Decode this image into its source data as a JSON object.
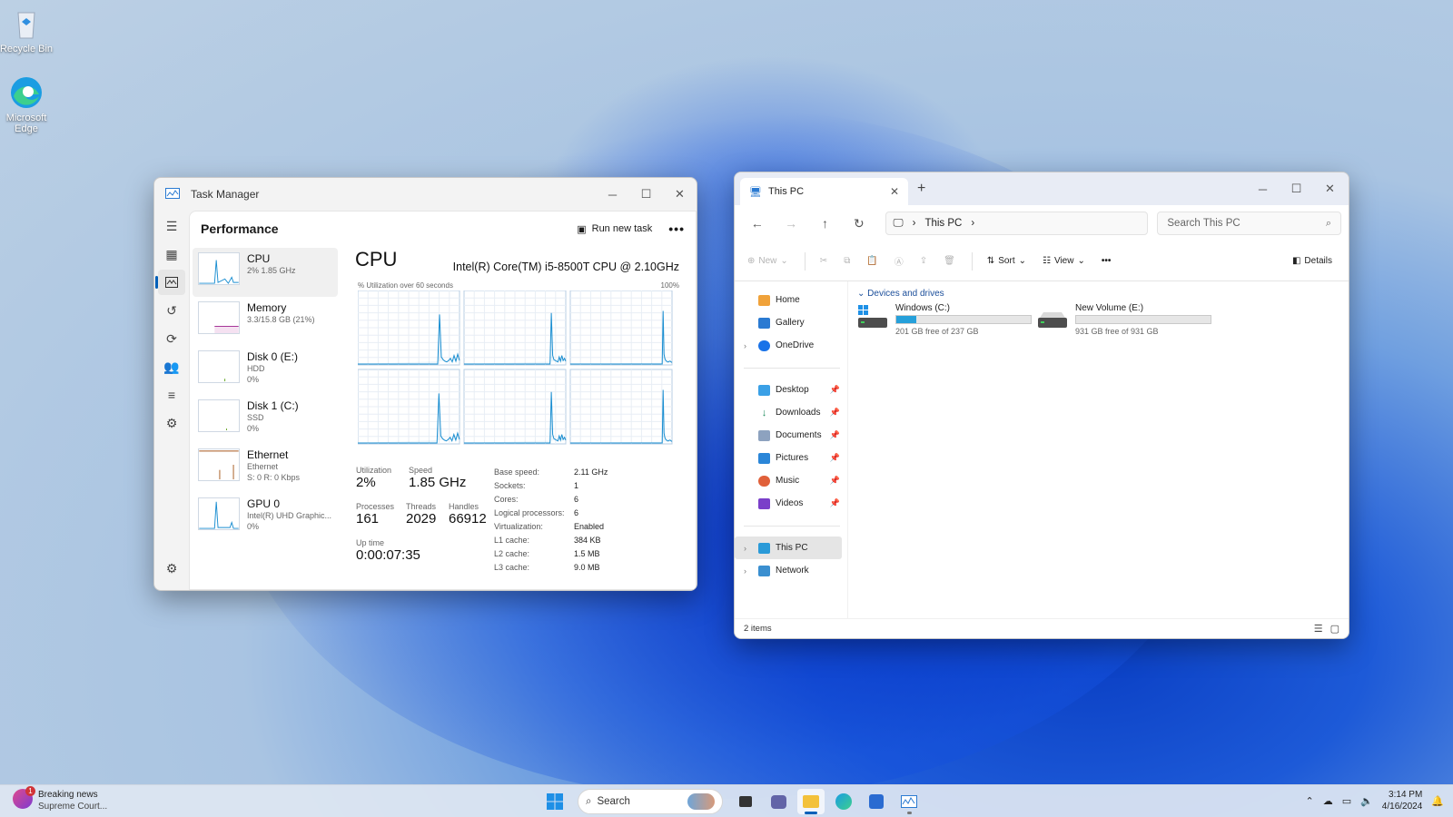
{
  "desktop": {
    "icons": [
      {
        "label": "Recycle Bin",
        "icon": "recycle-bin-icon"
      },
      {
        "label": "Microsoft Edge",
        "icon": "edge-icon"
      }
    ]
  },
  "task_manager": {
    "title": "Task Manager",
    "section": "Performance",
    "run_new_task": "Run new task",
    "more": "•••",
    "perf_items": [
      {
        "name": "CPU",
        "sub1": "2%  1.85 GHz",
        "sub2": ""
      },
      {
        "name": "Memory",
        "sub1": "3.3/15.8 GB (21%)",
        "sub2": ""
      },
      {
        "name": "Disk 0 (E:)",
        "sub1": "HDD",
        "sub2": "0%"
      },
      {
        "name": "Disk 1 (C:)",
        "sub1": "SSD",
        "sub2": "0%"
      },
      {
        "name": "Ethernet",
        "sub1": "Ethernet",
        "sub2": "S: 0  R: 0 Kbps"
      },
      {
        "name": "GPU 0",
        "sub1": "Intel(R) UHD Graphic...",
        "sub2": "0%"
      }
    ],
    "cpu": {
      "title": "CPU",
      "model": "Intel(R) Core(TM) i5-8500T CPU @ 2.10GHz",
      "util_label": "% Utilization over 60 seconds",
      "util_max": "100%",
      "utilization_label": "Utilization",
      "utilization": "2%",
      "speed_label": "Speed",
      "speed": "1.85 GHz",
      "processes_label": "Processes",
      "processes": "161",
      "threads_label": "Threads",
      "threads": "2029",
      "handles_label": "Handles",
      "handles": "66912",
      "uptime_label": "Up time",
      "uptime": "0:00:07:35",
      "specs": [
        {
          "k": "Base speed:",
          "v": "2.11 GHz"
        },
        {
          "k": "Sockets:",
          "v": "1"
        },
        {
          "k": "Cores:",
          "v": "6"
        },
        {
          "k": "Logical processors:",
          "v": "6"
        },
        {
          "k": "Virtualization:",
          "v": "Enabled"
        },
        {
          "k": "L1 cache:",
          "v": "384 KB"
        },
        {
          "k": "L2 cache:",
          "v": "1.5 MB"
        },
        {
          "k": "L3 cache:",
          "v": "9.0 MB"
        }
      ]
    }
  },
  "explorer": {
    "tab_title": "This PC",
    "breadcrumb": "This PC",
    "search_placeholder": "Search This PC",
    "commands": {
      "new": "New",
      "sort": "Sort",
      "view": "View",
      "more": "•••",
      "details": "Details"
    },
    "nav": {
      "home": "Home",
      "gallery": "Gallery",
      "onedrive": "OneDrive",
      "desktop": "Desktop",
      "downloads": "Downloads",
      "documents": "Documents",
      "pictures": "Pictures",
      "music": "Music",
      "videos": "Videos",
      "thispc": "This PC",
      "network": "Network"
    },
    "group": "Devices and drives",
    "drives": [
      {
        "name": "Windows (C:)",
        "free": "201 GB free of 237 GB",
        "used_fraction": 0.15
      },
      {
        "name": "New Volume (E:)",
        "free": "931 GB free of 931 GB",
        "used_fraction": 0.0
      }
    ],
    "status": "2 items"
  },
  "taskbar": {
    "news_title": "Breaking news",
    "news_sub": "Supreme Court...",
    "news_badge": "1",
    "search": "Search",
    "time": "3:14 PM",
    "date": "4/16/2024"
  },
  "colors": {
    "accent": "#005fb8",
    "cpu_graph": "#1a8ed1",
    "drive_fill": "#26a0da"
  }
}
